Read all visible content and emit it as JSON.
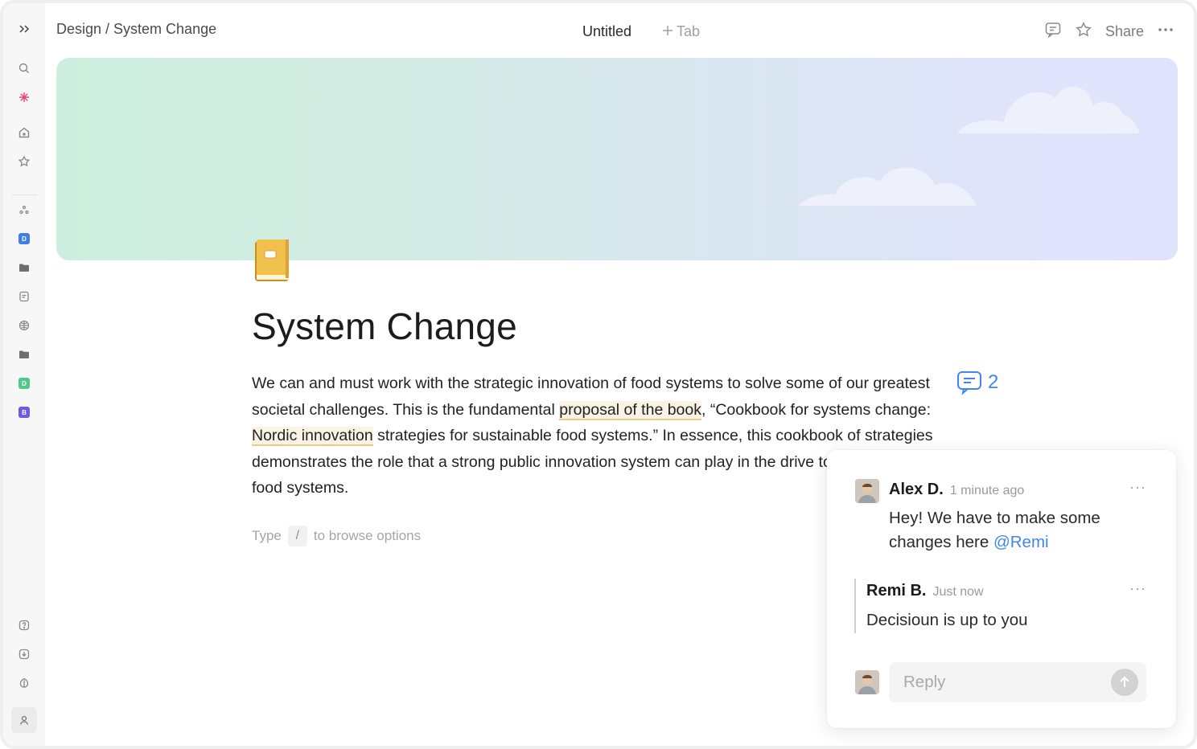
{
  "breadcrumb": "Design / System Change",
  "tabs": {
    "current": "Untitled",
    "add_label": "Tab"
  },
  "top_actions": {
    "share_label": "Share"
  },
  "rail": {
    "badges": [
      {
        "letter": "D",
        "color": "#3f7ee8"
      },
      {
        "letter": "D",
        "color": "#4fc98a"
      },
      {
        "letter": "B",
        "color": "#6a5be6"
      }
    ]
  },
  "page": {
    "icon": "yellow-book-icon",
    "title": "System Change",
    "paragraph": {
      "t1": "We can and must work with the strategic innovation of food systems to solve some of our greatest societal challenges. This is the fundamental ",
      "h1": "proposal of the book",
      "t2": ", “Cookbook for systems change: ",
      "h2": "Nordic innovation",
      "t3": " strategies for sustainable food systems.” In essence, this cookbook of strategies  demonstrates the role that a strong public innovation system can play in the drive towards sustainable food systems."
    },
    "slash_hint": {
      "before": "Type",
      "key": "/",
      "after": "to browse options"
    }
  },
  "comment_indicator": {
    "count": "2",
    "color": "#3f86f0"
  },
  "comments": [
    {
      "author": "Alex D.",
      "time": "1 minute ago",
      "text": "Hey! We have to make some changes here ",
      "mention": "@Remi"
    },
    {
      "author": "Remi B.",
      "time": "Just now",
      "text": "Decisioun is up to you"
    }
  ],
  "reply": {
    "placeholder": "Reply"
  }
}
